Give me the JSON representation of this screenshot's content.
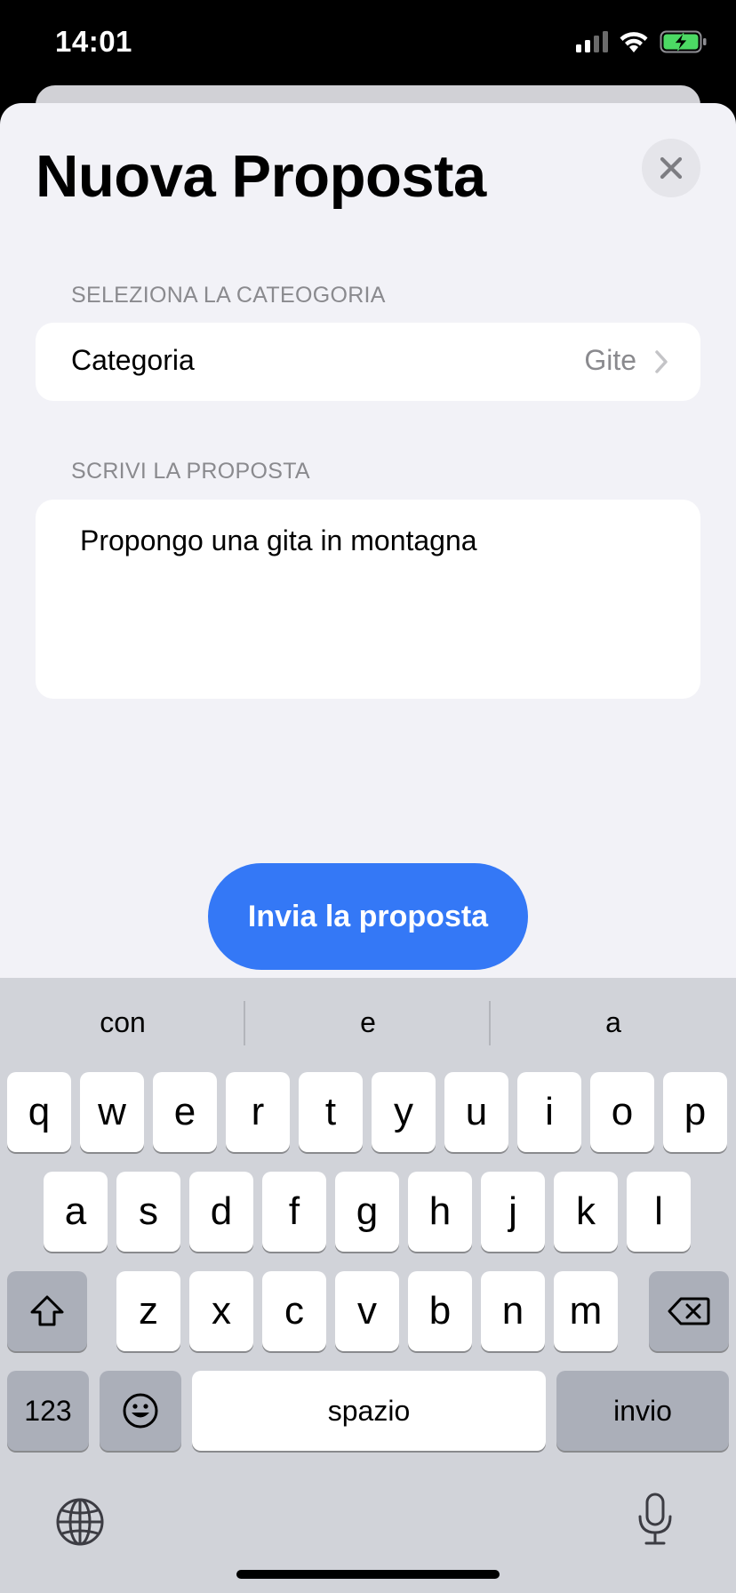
{
  "status_bar": {
    "time": "14:01",
    "icons": [
      "cellular-signal-icon",
      "wifi-icon",
      "battery-charging-icon"
    ]
  },
  "sheet": {
    "title": "Nuova Proposta",
    "close_icon": "close-icon",
    "category_section": {
      "header": "SELEZIONA LA CATEOGORIA",
      "label": "Categoria",
      "value": "Gite"
    },
    "proposal_section": {
      "header": "SCRIVI LA PROPOSTA",
      "text": "Propongo una gita in montagna"
    },
    "send_button": "Invia la proposta"
  },
  "keyboard": {
    "suggestions": [
      "con",
      "e",
      "a"
    ],
    "row1": [
      "q",
      "w",
      "e",
      "r",
      "t",
      "y",
      "u",
      "i",
      "o",
      "p"
    ],
    "row2": [
      "a",
      "s",
      "d",
      "f",
      "g",
      "h",
      "j",
      "k",
      "l"
    ],
    "row3": [
      "z",
      "x",
      "c",
      "v",
      "b",
      "n",
      "m"
    ],
    "numbers_key": "123",
    "space_key": "spazio",
    "return_key": "invio",
    "icons": [
      "shift-icon",
      "delete-icon",
      "emoji-icon",
      "globe-icon",
      "microphone-icon"
    ]
  },
  "colors": {
    "accent": "#3478f6",
    "sheet_background": "#f2f2f7",
    "keyboard_background": "#d1d3d9"
  }
}
